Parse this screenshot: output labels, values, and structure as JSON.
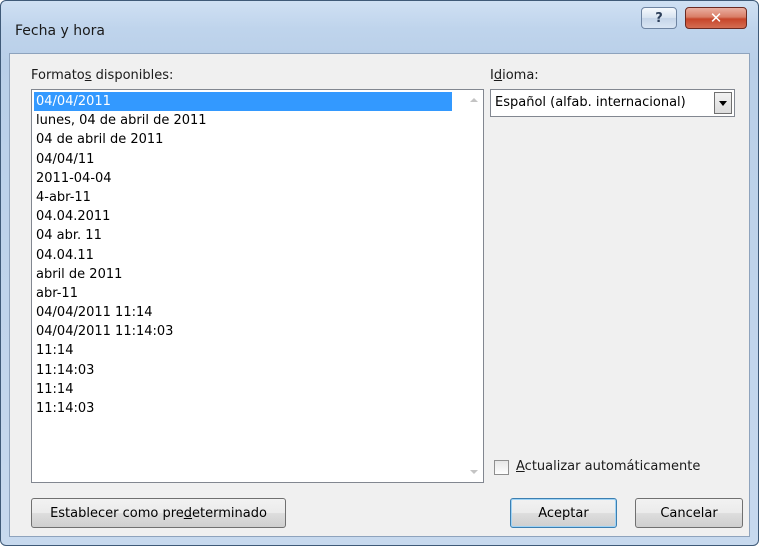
{
  "window": {
    "title": "Fecha y hora",
    "help_glyph": "?",
    "close_glyph": "✕"
  },
  "formats": {
    "label_pre": "Formato",
    "label_mnemonic": "s",
    "label_post": " disponibles:",
    "items": [
      "04/04/2011",
      "lunes, 04 de abril de 2011",
      "04 de abril de 2011",
      "04/04/11",
      "2011-04-04",
      "4-abr-11",
      "04.04.2011",
      "04 abr. 11",
      "04.04.11",
      "abril de 2011",
      "abr-11",
      "04/04/2011 11:14",
      "04/04/2011 11:14:03",
      "11:14",
      "11:14:03",
      "11:14",
      "11:14:03"
    ],
    "selected_index": 0
  },
  "language": {
    "label_pre": "I",
    "label_mnemonic": "d",
    "label_post": "ioma:",
    "selected": "Español (alfab. internacional)"
  },
  "auto_update": {
    "label_mnemonic": "A",
    "label_post": "ctualizar automáticamente",
    "checked": false
  },
  "buttons": {
    "set_default_pre": "Establecer como pre",
    "set_default_mnemonic": "d",
    "set_default_post": "eterminado",
    "accept": "Aceptar",
    "cancel": "Cancelar"
  },
  "colors": {
    "selection": "#3399ff",
    "title_frame": "#bfd4ec",
    "close_button": "#c7452a"
  }
}
